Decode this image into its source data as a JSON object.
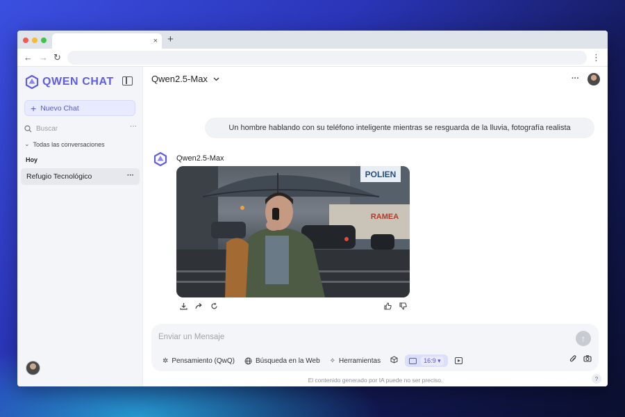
{
  "browser": {
    "tab_close": "×",
    "new_tab": "+",
    "back": "←",
    "forward": "→",
    "reload": "↻",
    "menu": "⋮",
    "url": ""
  },
  "sidebar": {
    "brand": "QWEN CHAT",
    "new_chat_label": "Nuevo Chat",
    "search_placeholder": "Buscar",
    "conversations_toggle": "Todas las conversaciones",
    "group_label": "Hoy",
    "items": [
      {
        "label": "Refugio Tecnológico"
      }
    ],
    "more": "···"
  },
  "header": {
    "model": "Qwen2.5-Max",
    "more": "···"
  },
  "conversation": {
    "user_message": "Un hombre hablando con su teléfono inteligente mientras se resguarda de la lluvia, fotografía realista",
    "assistant_name": "Qwen2.5-Max",
    "image": {
      "description_icon": "generated-image",
      "sign_top": "POLIEN",
      "sign_store": "RAMEA"
    }
  },
  "composer": {
    "placeholder": "Enviar un Mensaje",
    "tools": [
      {
        "label": "Pensamiento (QwQ)",
        "icon": "thinking-icon"
      },
      {
        "label": "Búsqueda en la Web",
        "icon": "globe-icon"
      },
      {
        "label": "Herramientas",
        "icon": "tools-icon"
      }
    ],
    "aspect_ratio": "16:9 ▾",
    "send": "↑"
  },
  "footer": {
    "disclaimer": "El contenido generado por IA puede no ser preciso.",
    "help": "?"
  },
  "colors": {
    "accent": "#615ce8",
    "sidebar_bg": "#f4f5f8",
    "chip_bg": "#dcdff9"
  }
}
